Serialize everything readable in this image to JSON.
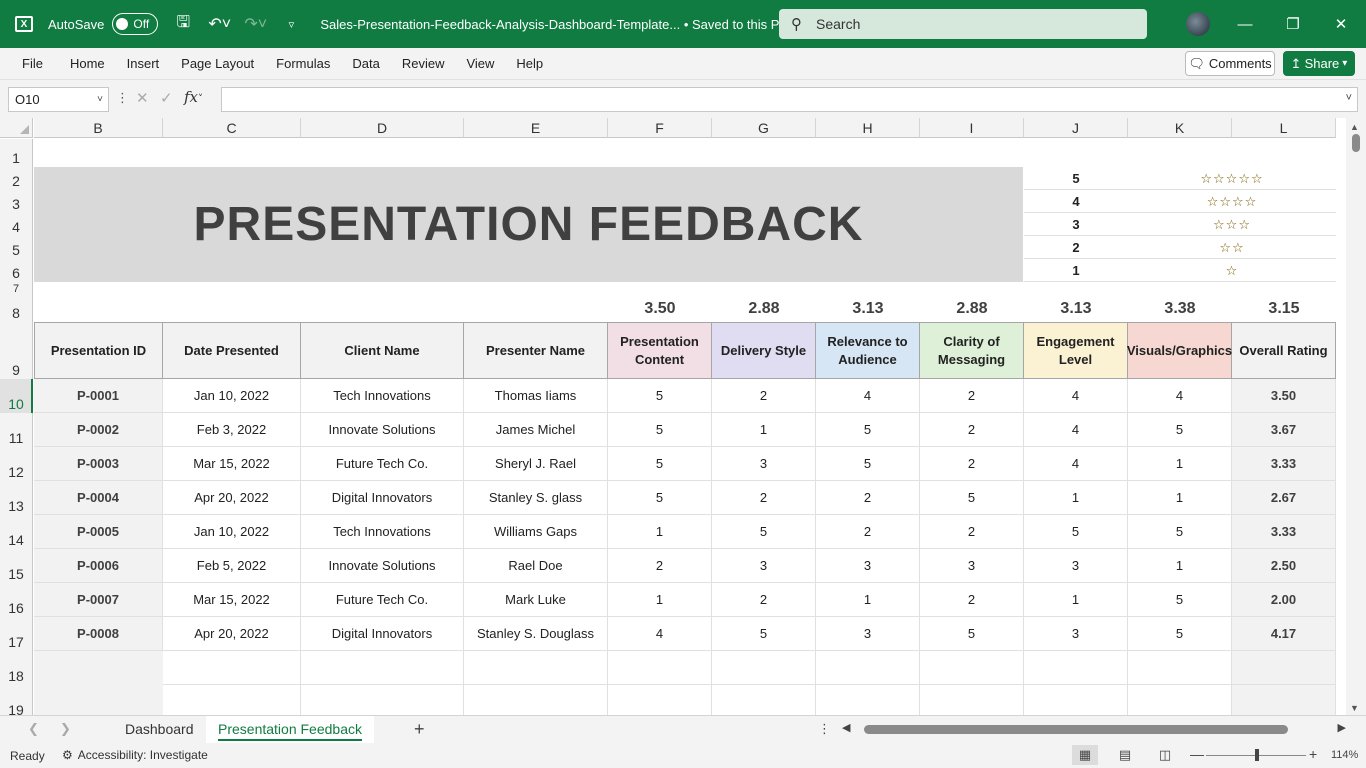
{
  "titlebar": {
    "autosave_label": "AutoSave",
    "toggle_label": "Off",
    "doc_title": "Sales-Presentation-Feedback-Analysis-Dashboard-Template...  •  Saved to this PC",
    "search_placeholder": "Search"
  },
  "menu": [
    "File",
    "Home",
    "Insert",
    "Page Layout",
    "Formulas",
    "Data",
    "Review",
    "View",
    "Help"
  ],
  "comments_label": "Comments",
  "share_label": "Share",
  "namebox": "O10",
  "fx_label": "fx",
  "columns": [
    "B",
    "C",
    "D",
    "E",
    "F",
    "G",
    "H",
    "I",
    "J",
    "K",
    "L"
  ],
  "rows": [
    "1",
    "2",
    "3",
    "4",
    "5",
    "6",
    "7",
    "8",
    "9",
    "10",
    "11",
    "12",
    "13",
    "14",
    "15",
    "16",
    "17",
    "18",
    "19"
  ],
  "banner_title": "PRESENTATION FEEDBACK",
  "rating_legend": [
    {
      "num": "5",
      "stars": "☆☆☆☆☆"
    },
    {
      "num": "4",
      "stars": "☆☆☆☆"
    },
    {
      "num": "3",
      "stars": "☆☆☆"
    },
    {
      "num": "2",
      "stars": "☆☆"
    },
    {
      "num": "1",
      "stars": "☆"
    }
  ],
  "averages": [
    "3.50",
    "2.88",
    "3.13",
    "2.88",
    "3.13",
    "3.38",
    "3.15"
  ],
  "headers": [
    "Presentation ID",
    "Date Presented",
    "Client Name",
    "Presenter Name",
    "Presentation Content",
    "Delivery Style",
    "Relevance to Audience",
    "Clarity of Messaging",
    "Engagement Level",
    "Visuals/Graphics",
    "Overall Rating"
  ],
  "header_colors": {
    "content": "#f2dfe6",
    "delivery": "#e0dcf2",
    "relevance": "#d6e6f5",
    "clarity": "#def0d7",
    "engagement": "#fbf2d4",
    "visuals": "#f6d7d1",
    "overall": "#f2f2f2"
  },
  "table_rows": [
    [
      "P-0001",
      "Jan 10, 2022",
      "Tech Innovations",
      "Thomas Iiams",
      "5",
      "2",
      "4",
      "2",
      "4",
      "4",
      "3.50"
    ],
    [
      "P-0002",
      "Feb 3, 2022",
      "Innovate Solutions",
      "James Michel",
      "5",
      "1",
      "5",
      "2",
      "4",
      "5",
      "3.67"
    ],
    [
      "P-0003",
      "Mar 15, 2022",
      "Future Tech Co.",
      "Sheryl J. Rael",
      "5",
      "3",
      "5",
      "2",
      "4",
      "1",
      "3.33"
    ],
    [
      "P-0004",
      "Apr 20, 2022",
      "Digital Innovators",
      "Stanley S. glass",
      "5",
      "2",
      "2",
      "5",
      "1",
      "1",
      "2.67"
    ],
    [
      "P-0005",
      "Jan 10, 2022",
      "Tech Innovations",
      "Williams Gaps",
      "1",
      "5",
      "2",
      "2",
      "5",
      "5",
      "3.33"
    ],
    [
      "P-0006",
      "Feb 5, 2022",
      "Innovate Solutions",
      "Rael Doe",
      "2",
      "3",
      "3",
      "3",
      "3",
      "1",
      "2.50"
    ],
    [
      "P-0007",
      "Mar 15, 2022",
      "Future Tech Co.",
      "Mark Luke",
      "1",
      "2",
      "1",
      "2",
      "1",
      "5",
      "2.00"
    ],
    [
      "P-0008",
      "Apr 20, 2022",
      "Digital Innovators",
      "Stanley S. Douglass",
      "4",
      "5",
      "3",
      "5",
      "3",
      "5",
      "4.17"
    ]
  ],
  "sheets": [
    "Dashboard",
    "Presentation Feedback"
  ],
  "status": {
    "ready": "Ready",
    "accessibility": "Accessibility: Investigate",
    "zoom": "114%"
  }
}
